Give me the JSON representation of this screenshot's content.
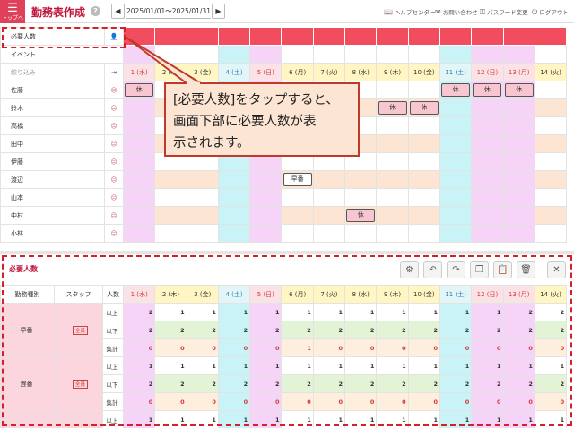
{
  "header": {
    "menu_label": "トップへ",
    "title": "勤務表作成",
    "help": "?",
    "prev": "◀",
    "next": "▶",
    "date_range": "2025/01/01～2025/01/31",
    "links": [
      {
        "icon": "📖",
        "label": "ヘルプセンター"
      },
      {
        "icon": "✉",
        "label": "お問い合わせ"
      },
      {
        "icon": "⚿",
        "label": "パスワード変更"
      },
      {
        "icon": "⏻",
        "label": "ログアウト"
      }
    ]
  },
  "schedule": {
    "required_label": "必要人数",
    "event_label": "イベント",
    "filter_placeholder": "絞り込み",
    "days": [
      {
        "label": "1 (水)",
        "kind": "holiday"
      },
      {
        "label": "2 (木)",
        "kind": "weekday"
      },
      {
        "label": "3 (金)",
        "kind": "weekday"
      },
      {
        "label": "4 (土)",
        "kind": "sat"
      },
      {
        "label": "5 (日)",
        "kind": "sun"
      },
      {
        "label": "6 (月)",
        "kind": "weekday"
      },
      {
        "label": "7 (火)",
        "kind": "weekday"
      },
      {
        "label": "8 (水)",
        "kind": "weekday"
      },
      {
        "label": "9 (木)",
        "kind": "weekday"
      },
      {
        "label": "10 (金)",
        "kind": "weekday"
      },
      {
        "label": "11 (土)",
        "kind": "sat"
      },
      {
        "label": "12 (日)",
        "kind": "sun"
      },
      {
        "label": "13 (月)",
        "kind": "holiday"
      },
      {
        "label": "14 (火)",
        "kind": "weekday"
      }
    ],
    "staff": [
      {
        "name": "佐藤",
        "shifts": {
          "0": "休",
          "10": "休",
          "11": "休",
          "12": "休"
        }
      },
      {
        "name": "鈴木",
        "shifts": {
          "8": "休",
          "9": "休"
        }
      },
      {
        "name": "高橋",
        "shifts": {}
      },
      {
        "name": "田中",
        "shifts": {}
      },
      {
        "name": "伊藤",
        "shifts": {}
      },
      {
        "name": "渡辺",
        "shifts": {
          "5": "早番"
        }
      },
      {
        "name": "山本",
        "shifts": {}
      },
      {
        "name": "中村",
        "shifts": {
          "7": "休"
        }
      },
      {
        "name": "小林",
        "shifts": {}
      }
    ]
  },
  "callout": {
    "lines": [
      "[必要人数]をタップすると、",
      "画面下部に必要人数が表",
      "示されます。"
    ]
  },
  "panel": {
    "title": "必要人数",
    "header_cols": [
      "勤務種別",
      "スタッフ",
      "人数"
    ],
    "badge": "全員",
    "groups": [
      {
        "kind": "早番",
        "rows": [
          {
            "label": "以上",
            "values": [
              2,
              1,
              1,
              1,
              1,
              1,
              1,
              1,
              1,
              1,
              1,
              1,
              2,
              2
            ]
          },
          {
            "label": "以下",
            "values": [
              2,
              2,
              2,
              2,
              2,
              2,
              2,
              2,
              2,
              2,
              2,
              2,
              2,
              2
            ]
          },
          {
            "label": "集計",
            "values": [
              0,
              0,
              0,
              0,
              0,
              1,
              0,
              0,
              0,
              0,
              0,
              0,
              0,
              0
            ]
          }
        ]
      },
      {
        "kind": "遅番",
        "rows": [
          {
            "label": "以上",
            "values": [
              1,
              1,
              1,
              1,
              1,
              1,
              1,
              1,
              1,
              1,
              1,
              1,
              1,
              1
            ]
          },
          {
            "label": "以下",
            "values": [
              2,
              2,
              2,
              2,
              2,
              2,
              2,
              2,
              2,
              2,
              2,
              2,
              2,
              2
            ]
          },
          {
            "label": "集計",
            "values": [
              0,
              0,
              0,
              0,
              0,
              0,
              0,
              0,
              0,
              0,
              0,
              0,
              0,
              0
            ]
          }
        ]
      },
      {
        "kind": "",
        "rows": [
          {
            "label": "以上",
            "values": [
              1,
              1,
              1,
              1,
              1,
              1,
              1,
              1,
              1,
              1,
              1,
              1,
              1,
              1
            ]
          }
        ]
      }
    ]
  }
}
